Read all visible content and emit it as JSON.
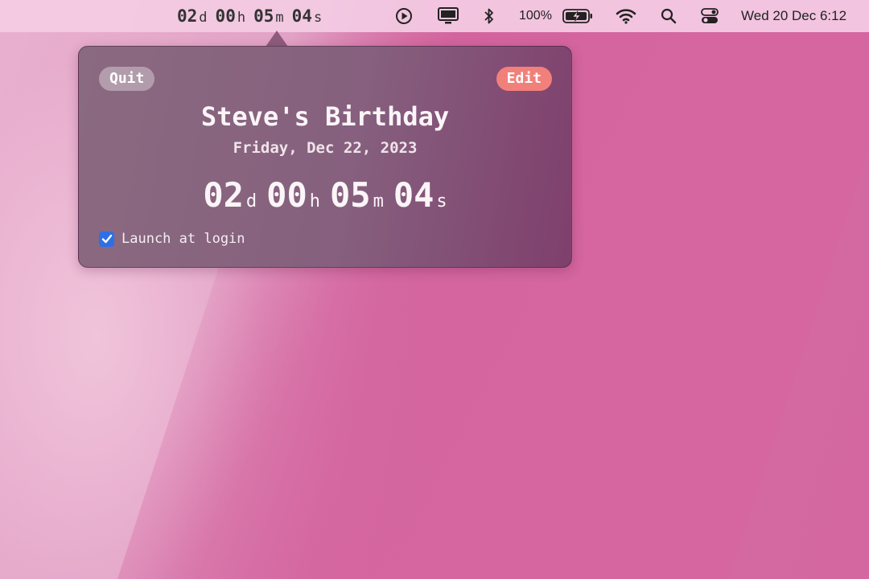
{
  "menubar": {
    "countdown": {
      "days": "02",
      "days_unit": "d",
      "hours": "00",
      "hours_unit": "h",
      "minutes": "05",
      "minutes_unit": "m",
      "seconds": "04",
      "seconds_unit": "s"
    },
    "icons": [
      "play-circle-icon",
      "display-icon",
      "bluetooth-icon",
      "battery-charging-icon",
      "wifi-icon",
      "search-icon",
      "control-center-icon"
    ],
    "battery_percent": "100%",
    "clock": "Wed 20 Dec  6:12"
  },
  "popover": {
    "quit_label": "Quit",
    "edit_label": "Edit",
    "event_title": "Steve's Birthday",
    "event_date": "Friday, Dec 22, 2023",
    "countdown": {
      "days": "02",
      "days_unit": "d",
      "hours": "00",
      "hours_unit": "h",
      "minutes": "05",
      "minutes_unit": "m",
      "seconds": "04",
      "seconds_unit": "s"
    },
    "launch_at_login_label": "Launch at login",
    "launch_at_login_checked": true
  },
  "colors": {
    "accent_edit": "#f1807a",
    "checkbox_blue": "#2f6fe6",
    "desktop_pink": "#d5669f",
    "popover_bg": "#86607e"
  }
}
